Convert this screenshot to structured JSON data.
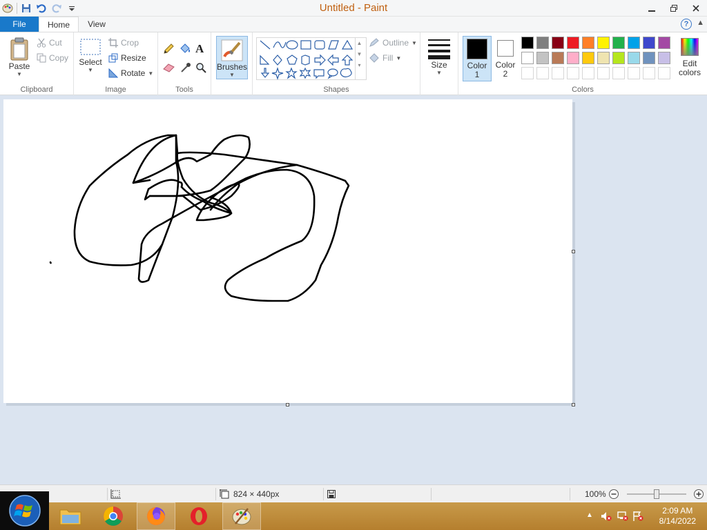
{
  "window": {
    "title": "Untitled - Paint"
  },
  "tabs": {
    "file": "File",
    "home": "Home",
    "view": "View"
  },
  "clipboard": {
    "paste": "Paste",
    "cut": "Cut",
    "copy": "Copy",
    "label": "Clipboard"
  },
  "image": {
    "select": "Select",
    "crop": "Crop",
    "resize": "Resize",
    "rotate": "Rotate",
    "label": "Image"
  },
  "tools": {
    "label": "Tools",
    "text_glyph": "A"
  },
  "brushes": {
    "label": "Brushes"
  },
  "shapes": {
    "outline": "Outline",
    "fill": "Fill",
    "label": "Shapes"
  },
  "size": {
    "label": "Size"
  },
  "colors": {
    "color1_line1": "Color",
    "color1_line2": "1",
    "color2_line1": "Color",
    "color2_line2": "2",
    "edit_line1": "Edit",
    "edit_line2": "colors",
    "label": "Colors",
    "color1": "#000000",
    "color2": "#ffffff",
    "palette_row1": [
      "#000000",
      "#7f7f7f",
      "#880015",
      "#ed1c24",
      "#ff7f27",
      "#fff200",
      "#22b14c",
      "#00a2e8",
      "#3f48cc",
      "#a349a4"
    ],
    "palette_row2": [
      "#ffffff",
      "#c3c3c3",
      "#b97a57",
      "#ffaec9",
      "#ffc90e",
      "#efe4b0",
      "#b5e61d",
      "#99d9ea",
      "#7092be",
      "#c8bfe7"
    ]
  },
  "status": {
    "canvas_size": "824 × 440px",
    "zoom": "100%",
    "zoom_fraction": 0.5
  },
  "taskbar": {
    "time": "2:09 AM",
    "date": "8/14/2022"
  }
}
